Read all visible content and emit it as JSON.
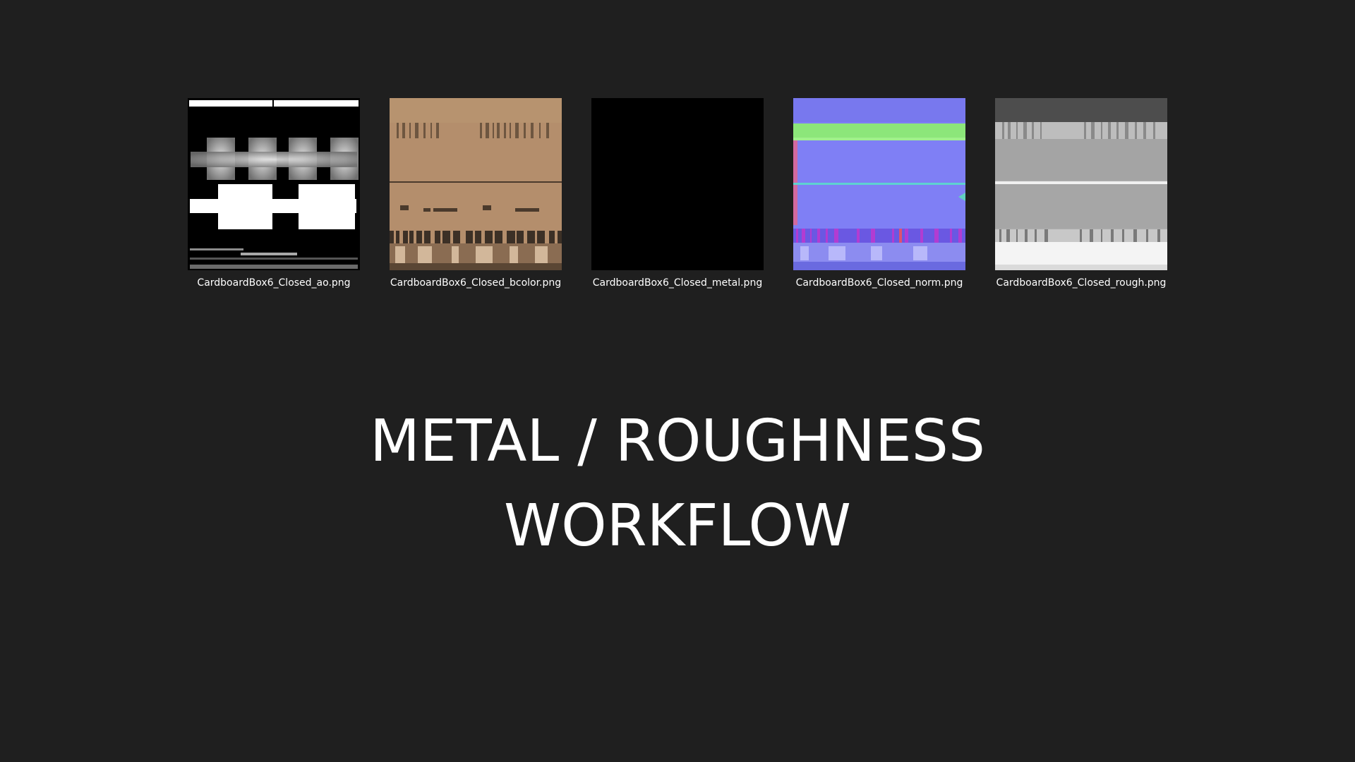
{
  "files": [
    {
      "name": "CardboardBox6_Closed_ao.png",
      "icon": "ao-texture-thumbnail"
    },
    {
      "name": "CardboardBox6_Closed_bcolor.png",
      "icon": "basecolor-texture-thumbnail"
    },
    {
      "name": "CardboardBox6_Closed_metal.png",
      "icon": "metal-texture-thumbnail"
    },
    {
      "name": "CardboardBox6_Closed_norm.png",
      "icon": "normal-texture-thumbnail"
    },
    {
      "name": "CardboardBox6_Closed_rough.png",
      "icon": "roughness-texture-thumbnail"
    }
  ],
  "title": {
    "line1": "METAL / ROUGHNESS",
    "line2": "WORKFLOW"
  },
  "colors": {
    "background": "#1f1f1f",
    "text": "#ffffff",
    "cardboard": "#b48e6c",
    "normal": "#7f7ff5"
  }
}
